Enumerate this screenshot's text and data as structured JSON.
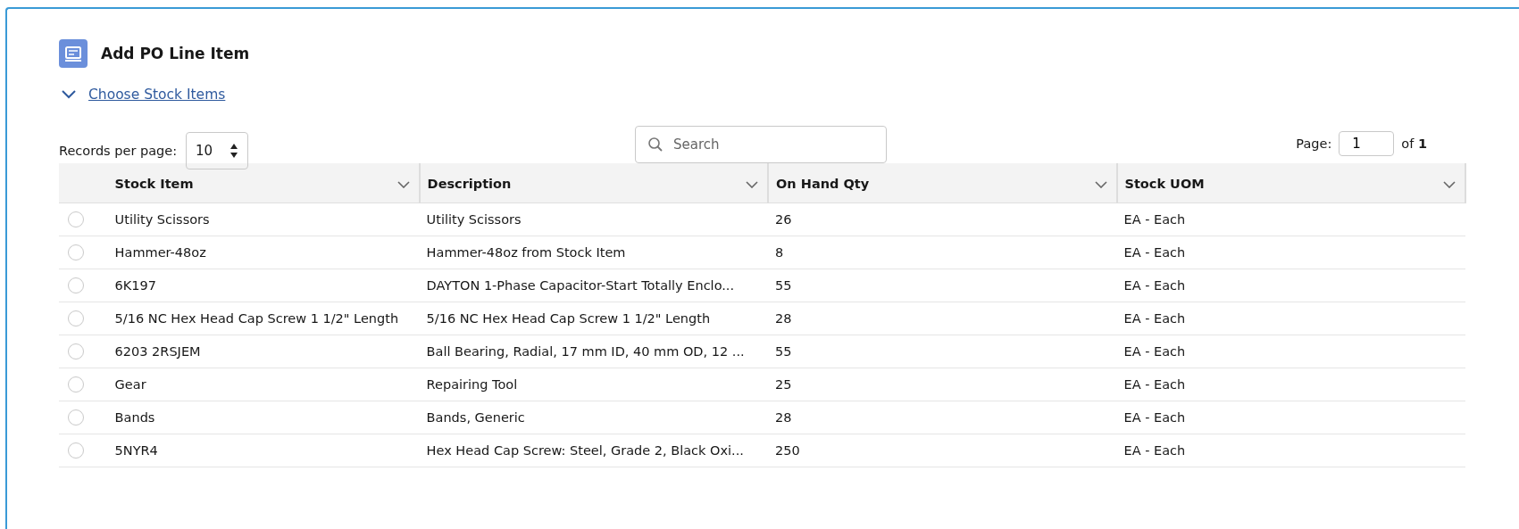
{
  "panel": {
    "title": "Add PO Line Item"
  },
  "section": {
    "label": "Choose Stock Items",
    "expanded": true
  },
  "records_per_page": {
    "label": "Records per page:",
    "value": "10"
  },
  "search": {
    "placeholder": "Search"
  },
  "pager": {
    "label": "Page:",
    "value": "1",
    "of_label": "of",
    "total": "1"
  },
  "table": {
    "columns": [
      "Stock Item",
      "Description",
      "On Hand Qty",
      "Stock UOM"
    ],
    "rows": [
      {
        "selected": false,
        "cells": [
          "Utility Scissors",
          "Utility Scissors",
          "26",
          "EA - Each"
        ]
      },
      {
        "selected": false,
        "cells": [
          "Hammer-48oz",
          "Hammer-48oz from Stock Item",
          "8",
          "EA - Each"
        ]
      },
      {
        "selected": false,
        "cells": [
          "6K197",
          "DAYTON 1-Phase Capacitor-Start Totally Enclo...",
          "55",
          "EA - Each"
        ]
      },
      {
        "selected": false,
        "cells": [
          "5/16 NC Hex Head Cap Screw 1 1/2\" Length",
          "5/16 NC Hex Head Cap Screw 1 1/2\" Length",
          "28",
          "EA - Each"
        ]
      },
      {
        "selected": false,
        "cells": [
          "6203 2RSJEM",
          "Ball Bearing, Radial, 17 mm ID, 40 mm OD, 12 ...",
          "55",
          "EA - Each"
        ]
      },
      {
        "selected": false,
        "cells": [
          "Gear",
          "Repairing Tool",
          "25",
          "EA - Each"
        ]
      },
      {
        "selected": false,
        "cells": [
          "Bands",
          "Bands, Generic",
          "28",
          "EA - Each"
        ]
      },
      {
        "selected": false,
        "cells": [
          "5NYR4",
          "Hex Head Cap Screw: Steel, Grade 2, Black Oxi...",
          "250",
          "EA - Each"
        ]
      }
    ]
  }
}
